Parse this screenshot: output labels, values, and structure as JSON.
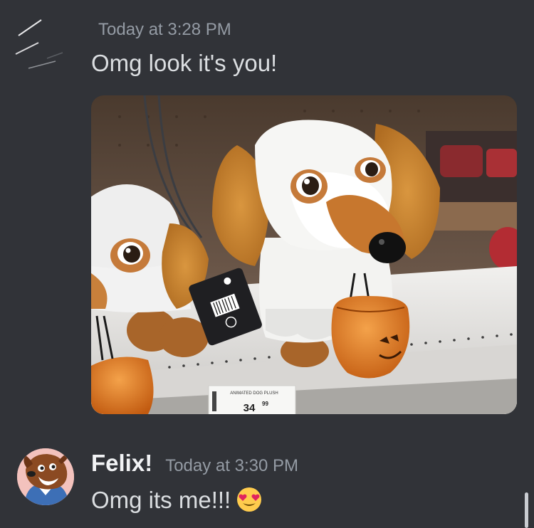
{
  "messages": [
    {
      "author": "",
      "timestamp": "Today at 3:28 PM",
      "text": "Omg look it's you!",
      "attachment": {
        "type": "image",
        "icon": "ghost-dog-plush-photo",
        "price_tag_label": "ANIMATED DOG PLUSH",
        "price_tag_price": "34",
        "price_tag_cents": "99"
      }
    },
    {
      "author": "Felix!",
      "timestamp": "Today at 3:30 PM",
      "text": "Omg its me!!!",
      "emoji": "heart-eyes-emoji"
    }
  ],
  "colors": {
    "background": "#313338",
    "text": "#dbdee1",
    "muted": "#949ba4",
    "author": "#f2f3f5"
  }
}
